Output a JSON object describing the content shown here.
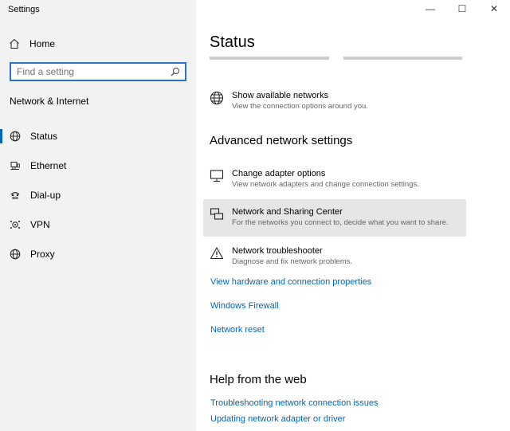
{
  "window": {
    "title": "Settings",
    "controls": [
      "—",
      "☐",
      "✕"
    ]
  },
  "sidebar": {
    "home_label": "Home",
    "search_placeholder": "Find a setting",
    "section_label": "Network & Internet",
    "items": [
      {
        "label": "Status",
        "icon": "globe-icon",
        "active": true
      },
      {
        "label": "Ethernet",
        "icon": "ethernet-icon"
      },
      {
        "label": "Dial-up",
        "icon": "dialup-icon"
      },
      {
        "label": "VPN",
        "icon": "vpn-icon"
      },
      {
        "label": "Proxy",
        "icon": "globe-icon"
      }
    ]
  },
  "main": {
    "title": "Status",
    "show_networks": {
      "title": "Show available networks",
      "desc": "View the connection options around you."
    },
    "advanced_heading": "Advanced network settings",
    "options": [
      {
        "title": "Change adapter options",
        "desc": "View network adapters and change connection settings.",
        "icon": "monitor-icon"
      },
      {
        "title": "Network and Sharing Center",
        "desc": "For the networks you connect to, decide what you want to share.",
        "icon": "sharing-center-icon",
        "hovered": true
      },
      {
        "title": "Network troubleshooter",
        "desc": "Diagnose and fix network problems.",
        "icon": "warning-icon"
      }
    ],
    "links": [
      "View hardware and connection properties",
      "Windows Firewall",
      "Network reset"
    ],
    "help_heading": "Help from the web",
    "help_links": [
      "Troubleshooting network connection issues",
      "Updating network adapter or driver"
    ]
  }
}
